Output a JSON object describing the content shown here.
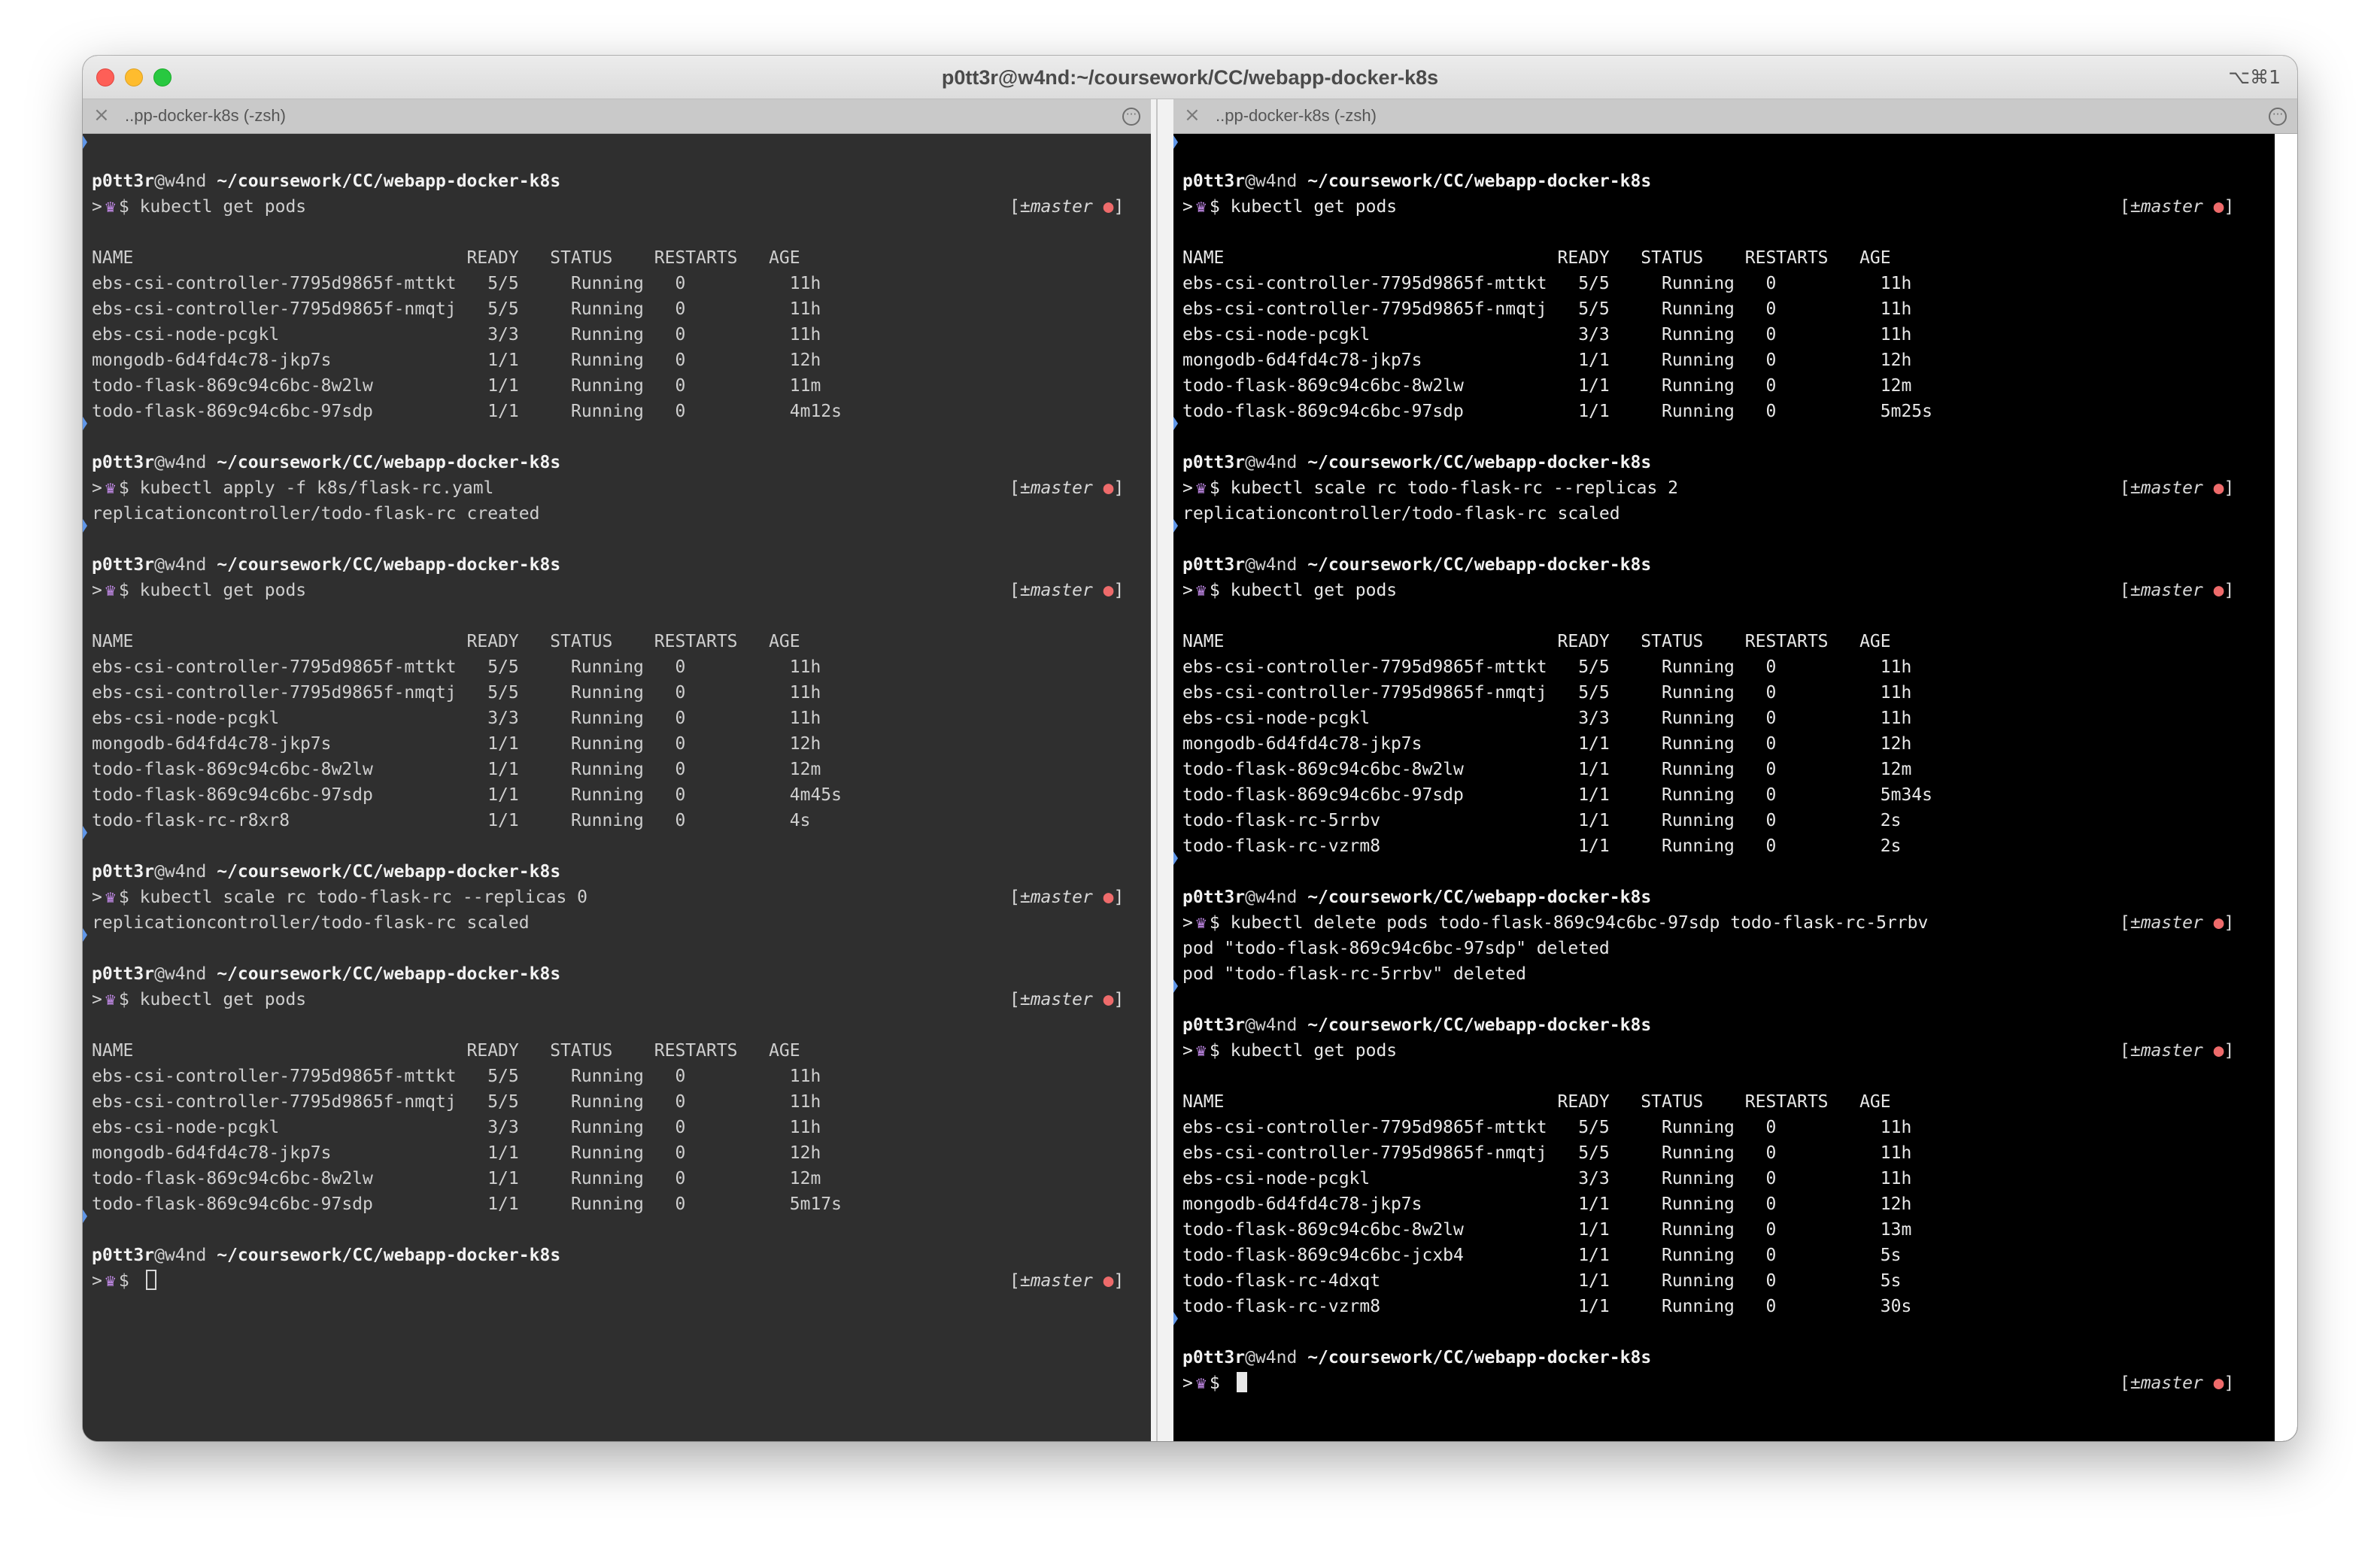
{
  "window": {
    "title": "p0tt3r@w4nd:~/coursework/CC/webapp-docker-k8s",
    "shortcut": "⌥⌘1"
  },
  "tabs": [
    {
      "label": "..pp-docker-k8s (-zsh)"
    },
    {
      "label": "..pp-docker-k8s (-zsh)"
    }
  ],
  "prompt": {
    "user": "p0tt3r",
    "host": "@w4nd",
    "path": "~/coursework/CC/webapp-docker-k8s",
    "symbol": ">",
    "dollar": "$",
    "branch": "±master",
    "bracket_open": "[",
    "bracket_close": "]",
    "dot": "●"
  },
  "panes": {
    "left": {
      "cmd1": "kubectl get pods",
      "table1": {
        "header": "NAME                                READY   STATUS    RESTARTS   AGE",
        "rows": [
          "ebs-csi-controller-7795d9865f-mttkt   5/5     Running   0          11h",
          "ebs-csi-controller-7795d9865f-nmqtj   5/5     Running   0          11h",
          "ebs-csi-node-pcgkl                    3/3     Running   0          11h",
          "mongodb-6d4fd4c78-jkp7s               1/1     Running   0          12h",
          "todo-flask-869c94c6bc-8w2lw           1/1     Running   0          11m",
          "todo-flask-869c94c6bc-97sdp           1/1     Running   0          4m12s"
        ]
      },
      "cmd2": "kubectl apply -f k8s/flask-rc.yaml",
      "out2": "replicationcontroller/todo-flask-rc created",
      "cmd3": "kubectl get pods",
      "table3": {
        "header": "NAME                                READY   STATUS    RESTARTS   AGE",
        "rows": [
          "ebs-csi-controller-7795d9865f-mttkt   5/5     Running   0          11h",
          "ebs-csi-controller-7795d9865f-nmqtj   5/5     Running   0          11h",
          "ebs-csi-node-pcgkl                    3/3     Running   0          11h",
          "mongodb-6d4fd4c78-jkp7s               1/1     Running   0          12h",
          "todo-flask-869c94c6bc-8w2lw           1/1     Running   0          12m",
          "todo-flask-869c94c6bc-97sdp           1/1     Running   0          4m45s",
          "todo-flask-rc-r8xr8                   1/1     Running   0          4s"
        ]
      },
      "cmd4": "kubectl scale rc todo-flask-rc --replicas 0",
      "out4": "replicationcontroller/todo-flask-rc scaled",
      "cmd5": "kubectl get pods",
      "table5": {
        "header": "NAME                                READY   STATUS    RESTARTS   AGE",
        "rows": [
          "ebs-csi-controller-7795d9865f-mttkt   5/5     Running   0          11h",
          "ebs-csi-controller-7795d9865f-nmqtj   5/5     Running   0          11h",
          "ebs-csi-node-pcgkl                    3/3     Running   0          11h",
          "mongodb-6d4fd4c78-jkp7s               1/1     Running   0          12h",
          "todo-flask-869c94c6bc-8w2lw           1/1     Running   0          12m",
          "todo-flask-869c94c6bc-97sdp           1/1     Running   0          5m17s"
        ]
      }
    },
    "right": {
      "cmd1": "kubectl get pods",
      "table1": {
        "header": "NAME                                READY   STATUS    RESTARTS   AGE",
        "rows": [
          "ebs-csi-controller-7795d9865f-mttkt   5/5     Running   0          11h",
          "ebs-csi-controller-7795d9865f-nmqtj   5/5     Running   0          11h",
          "ebs-csi-node-pcgkl                    3/3     Running   0          11h",
          "mongodb-6d4fd4c78-jkp7s               1/1     Running   0          12h",
          "todo-flask-869c94c6bc-8w2lw           1/1     Running   0          12m",
          "todo-flask-869c94c6bc-97sdp           1/1     Running   0          5m25s"
        ]
      },
      "cmd2": "kubectl scale rc todo-flask-rc --replicas 2",
      "out2": "replicationcontroller/todo-flask-rc scaled",
      "cmd3": "kubectl get pods",
      "table3": {
        "header": "NAME                                READY   STATUS    RESTARTS   AGE",
        "rows": [
          "ebs-csi-controller-7795d9865f-mttkt   5/5     Running   0          11h",
          "ebs-csi-controller-7795d9865f-nmqtj   5/5     Running   0          11h",
          "ebs-csi-node-pcgkl                    3/3     Running   0          11h",
          "mongodb-6d4fd4c78-jkp7s               1/1     Running   0          12h",
          "todo-flask-869c94c6bc-8w2lw           1/1     Running   0          12m",
          "todo-flask-869c94c6bc-97sdp           1/1     Running   0          5m34s",
          "todo-flask-rc-5rrbv                   1/1     Running   0          2s",
          "todo-flask-rc-vzrm8                   1/1     Running   0          2s"
        ]
      },
      "cmd4": "kubectl delete pods todo-flask-869c94c6bc-97sdp todo-flask-rc-5rrbv",
      "out4a": "pod \"todo-flask-869c94c6bc-97sdp\" deleted",
      "out4b": "pod \"todo-flask-rc-5rrbv\" deleted",
      "cmd5": "kubectl get pods",
      "table5": {
        "header": "NAME                                READY   STATUS    RESTARTS   AGE",
        "rows": [
          "ebs-csi-controller-7795d9865f-mttkt   5/5     Running   0          11h",
          "ebs-csi-controller-7795d9865f-nmqtj   5/5     Running   0          11h",
          "ebs-csi-node-pcgkl                    3/3     Running   0          11h",
          "mongodb-6d4fd4c78-jkp7s               1/1     Running   0          12h",
          "todo-flask-869c94c6bc-8w2lw           1/1     Running   0          13m",
          "todo-flask-869c94c6bc-jcxb4           1/1     Running   0          5s",
          "todo-flask-rc-4dxqt                   1/1     Running   0          5s",
          "todo-flask-rc-vzrm8                   1/1     Running   0          30s"
        ]
      }
    }
  }
}
